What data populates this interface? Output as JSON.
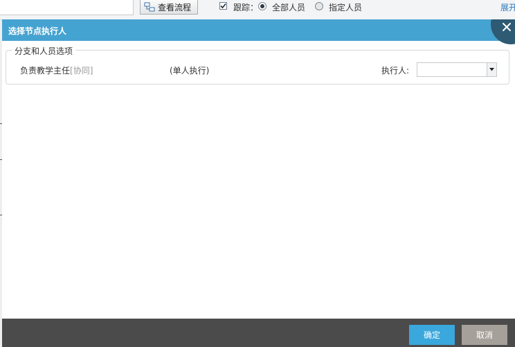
{
  "toolbar": {
    "view_flow_label": "查看流程",
    "track_label": "跟踪：",
    "track_checked": true,
    "radio_all_label": "全部人员",
    "radio_all_selected": true,
    "radio_specified_label": "指定人员",
    "expand_label": "展开"
  },
  "dialog": {
    "title": "选择节点执行人",
    "section_legend": "分支和人员选项",
    "branch": {
      "name": "负责教学主任",
      "tag": "[协同]",
      "mode": "(单人执行)",
      "executor_label": "执行人:",
      "executor_value": ""
    },
    "footer": {
      "ok_label": "确定",
      "cancel_label": "取消"
    }
  },
  "colors": {
    "header": "#45a3d1",
    "close_corner": "#2e5a73",
    "footer": "#4b4b4b",
    "ok_button": "#3aa7dd",
    "cancel_button": "#a6a09a",
    "link": "#2c79c0"
  }
}
